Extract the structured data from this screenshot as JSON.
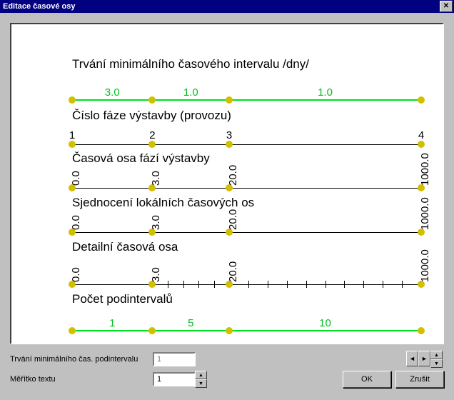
{
  "window": {
    "title": "Editace časové osy"
  },
  "sections": {
    "duration_days": "Trvání minimálního časového intervalu /dny/",
    "phase_number": "Číslo fáze výstavby (provozu)",
    "phase_axis": "Časová osa fází výstavby",
    "unified": "Sjednocení lokálních časových os",
    "detail": "Detailní časová osa",
    "subcount": "Počet podintervalů"
  },
  "chart_data": [
    {
      "id": "duration_days",
      "type": "line",
      "color": "green",
      "nodes": [
        0,
        23,
        45,
        100
      ],
      "segment_labels": [
        "3.0",
        "1.0",
        "1.0"
      ]
    },
    {
      "id": "phase_number",
      "type": "line",
      "color": "black",
      "nodes": [
        0,
        23,
        45,
        100
      ],
      "node_labels": [
        "1",
        "2",
        "3",
        "4"
      ],
      "node_orient": "horizontal"
    },
    {
      "id": "phase_axis",
      "type": "line",
      "color": "black",
      "nodes": [
        0,
        23,
        45,
        100
      ],
      "node_labels": [
        "0.0",
        "3.0",
        "20.0",
        "1000.0"
      ],
      "node_orient": "vertical"
    },
    {
      "id": "unified",
      "type": "line",
      "color": "black",
      "nodes": [
        0,
        23,
        45,
        100
      ],
      "node_labels": [
        "0.0",
        "3.0",
        "20.0",
        "1000.0"
      ],
      "node_orient": "vertical"
    },
    {
      "id": "detail",
      "type": "line",
      "color": "black",
      "nodes": [
        0,
        23,
        45,
        100
      ],
      "node_labels": [
        "0.0",
        "3.0",
        "20.0",
        "1000.0"
      ],
      "node_orient": "vertical",
      "ticks": 16
    },
    {
      "id": "subcount",
      "type": "line",
      "color": "green",
      "nodes": [
        0,
        23,
        45,
        100
      ],
      "segment_labels": [
        "1",
        "5",
        "10"
      ]
    }
  ],
  "controls": {
    "min_subinterval_label": "Trvání minimálního čas. podintervalu",
    "min_subinterval_value": "1",
    "text_scale_label": "Měřítko textu",
    "text_scale_value": "1"
  },
  "buttons": {
    "ok": "OK",
    "cancel": "Zrušit"
  },
  "glyphs": {
    "x": "✕",
    "up": "▲",
    "down": "▼",
    "left": "◄",
    "right": "►"
  }
}
